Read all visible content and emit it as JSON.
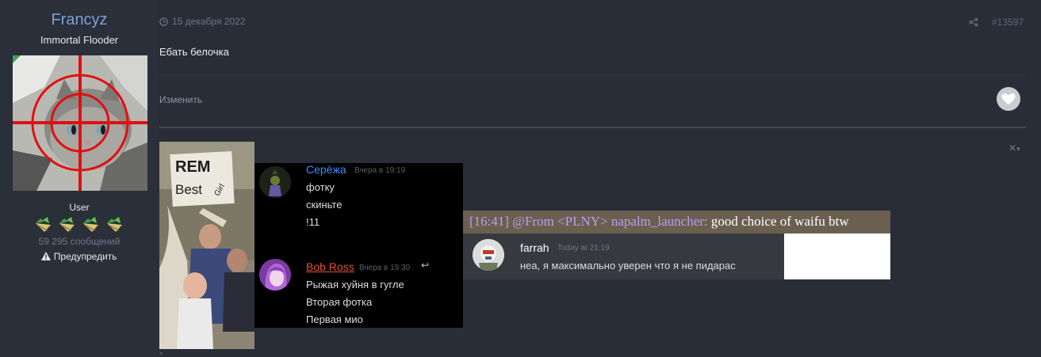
{
  "user": {
    "name": "Francyz",
    "title": "Immortal Flooder",
    "role": "User",
    "post_count": "59 295 сообщений",
    "warn_label": "Предупредить",
    "rank_pips": 4
  },
  "post": {
    "date": "15 декабря 2022",
    "number": "#13597",
    "text": "Ебать белочка",
    "edit_label": "Изменить"
  },
  "signature": {
    "rem_sign_line1": "REM",
    "rem_sign_line2": "Best",
    "rem_sign_line3": "Girl",
    "discord_chat_1": {
      "messages": [
        {
          "author": "Серёжа",
          "author_color": "#3f8cff",
          "time": "Вчера в 19:19",
          "lines": [
            "фотку",
            "скиньте",
            "!11"
          ]
        },
        {
          "author": "Bob Ross",
          "author_color": "#e0513a",
          "time": "Вчера в 19:30",
          "lines": [
            "Рыжая хуйня в гугле",
            "Вторая фотка",
            "Первая мио"
          ]
        }
      ]
    },
    "discord_chat_2": {
      "irc_time": "[16:41]",
      "irc_nick": "@From <PLNY> napalm_launcher:",
      "irc_message": "good choice of waifu btw",
      "author": "farrah",
      "time": "Today at 21:19",
      "text": "неа, я максимально уверен что я не пидарас"
    }
  },
  "colors": {
    "page_bg": "#282d38",
    "username": "#7ea1d3",
    "muted": "#6f7785",
    "online": "#3fa35a"
  },
  "icons": [
    "clock-icon",
    "share-icon",
    "heart-icon",
    "warning-icon",
    "close-icon",
    "chevron-down-icon",
    "reply-icon"
  ]
}
